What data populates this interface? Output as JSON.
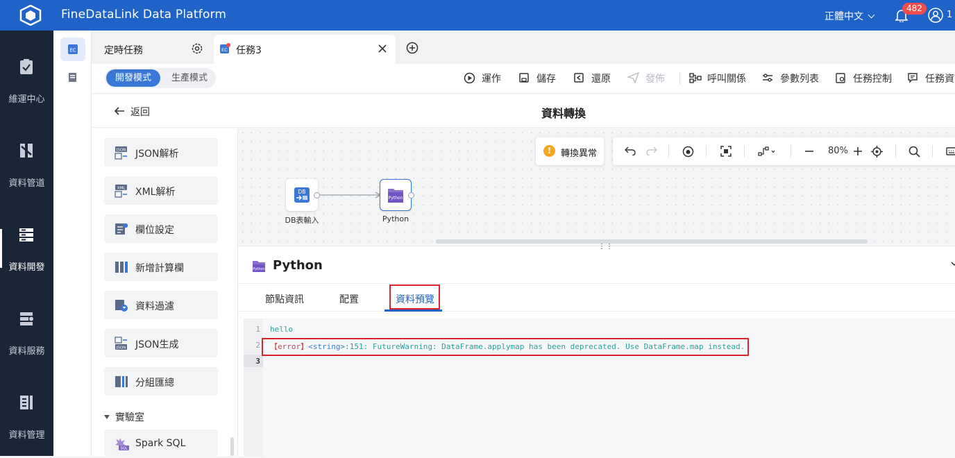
{
  "app": {
    "title": "FineDataLink Data Platform",
    "language": "正體中文",
    "notification_count": "482",
    "user_suffix": "1"
  },
  "left_nav": [
    {
      "label": "維運中心",
      "icon": "clipboard-check-icon"
    },
    {
      "label": "資料管道",
      "icon": "pipeline-icon"
    },
    {
      "label": "資料開發",
      "icon": "data-dev-icon",
      "active": true
    },
    {
      "label": "資料服務",
      "icon": "data-service-icon"
    },
    {
      "label": "資料管理",
      "icon": "data-manage-icon"
    }
  ],
  "tabs": {
    "scheduled": "定時任務",
    "current": "任務3"
  },
  "toolbar": {
    "mode_dev": "開發模式",
    "mode_prod": "生產模式",
    "run": "運作",
    "save": "儲存",
    "restore": "還原",
    "publish": "發佈",
    "call_relation": "呼叫關係",
    "param_list": "參數列表",
    "task_control": "任務控制",
    "task_info": "任務資訊"
  },
  "title_bar": {
    "back": "返回",
    "title": "資料轉換"
  },
  "palette": {
    "items": [
      "JSON解析",
      "XML解析",
      "欄位設定",
      "新增計算欄",
      "資料過濾",
      "JSON生成",
      "分組匯總"
    ],
    "lab_section": "實驗室",
    "lab_items": [
      "Spark SQL"
    ]
  },
  "canvas": {
    "exception_label": "轉換異常",
    "zoom": "80%",
    "nodes": [
      {
        "label": "DB表輸入",
        "badge": "DB"
      },
      {
        "label": "Python",
        "badge": "Python"
      }
    ]
  },
  "detail": {
    "node_title": "Python",
    "tabs": [
      "節點資訊",
      "配置",
      "資料預覽"
    ],
    "active_tab": "資料預覽",
    "code_lines": [
      {
        "num": "1",
        "text": "hello"
      },
      {
        "num": "2",
        "prefix": "【error】",
        "tag": "<string>",
        "rest": ":151: FutureWarning: DataFrame.applymap has been deprecated. Use DataFrame.map instead."
      },
      {
        "num": "3",
        "text": ""
      }
    ]
  },
  "colors": {
    "brand": "#1f63c8",
    "nav_bg": "#1a2538",
    "highlight": "#e0242c"
  }
}
